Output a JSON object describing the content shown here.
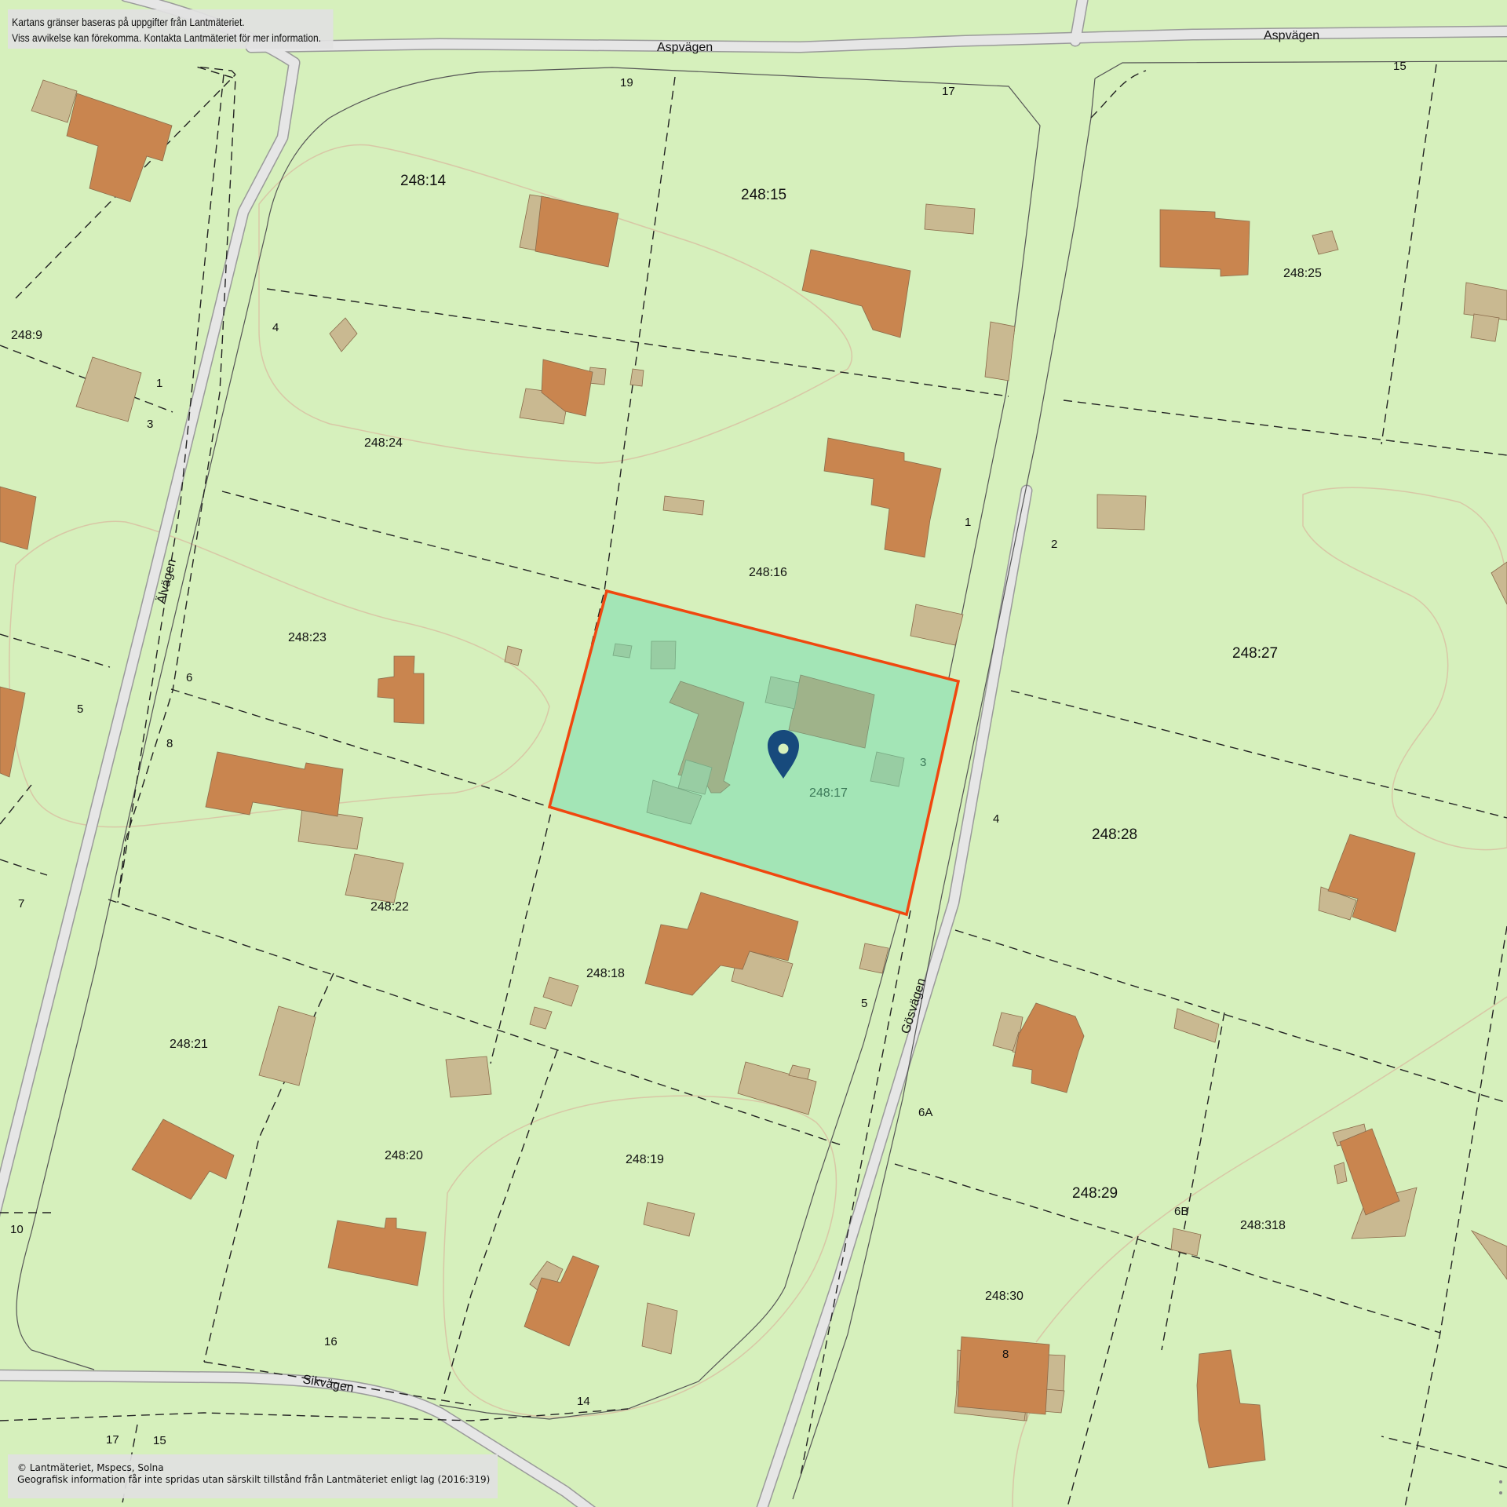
{
  "map": {
    "colors": {
      "land": "#d6f0bc",
      "building_main": "#c9854f",
      "building_annex": "#c9b991",
      "road": "#e6e6e6",
      "road_edge": "#9a9a9a",
      "selected_fill": "#a3e5b6",
      "selected_border": "#f0470f",
      "pin": "#174a7c"
    },
    "roads": {
      "aspvagen": "Aspvägen",
      "alvagen": "Älvägen",
      "gosvagen": "Gösvägen",
      "sikvagen": "Sikvägen"
    },
    "parcels": {
      "p248_14": "248:14",
      "p248_15": "248:15",
      "p248_25": "248:25",
      "p248_9": "248:9",
      "p248_24": "248:24",
      "p248_16": "248:16",
      "p248_23": "248:23",
      "p248_27": "248:27",
      "p248_17": "248:17",
      "p248_28": "248:28",
      "p248_22": "248:22",
      "p248_18": "248:18",
      "p248_21": "248:21",
      "p248_20": "248:20",
      "p248_19": "248:19",
      "p248_29": "248:29",
      "p248_318": "248:318",
      "p248_30": "248:30"
    },
    "addresses": {
      "a19": "19",
      "a17_top": "17",
      "a15_top": "15",
      "a4_left": "4",
      "a1_left": "1",
      "a3_left": "3",
      "a1_gos": "1",
      "a2_gos": "2",
      "a6": "6",
      "a5": "5",
      "a8_left": "8",
      "a3_sel": "3",
      "a4_gos": "4",
      "a7": "7",
      "a5_gos": "5",
      "a6A": "6A",
      "a6B": "6B",
      "a10": "10",
      "a16": "16",
      "a14": "14",
      "a8_bottom": "8",
      "a17_bottom": "17",
      "a15_bottom": "15"
    },
    "selected_parcel": {
      "id": "248:17",
      "marker": "location-pin"
    }
  },
  "notices": {
    "top_line1": "Kartans gränser baseras på uppgifter från Lantmäteriet.",
    "top_line2": "Viss avvikelse kan förekomma. Kontakta Lantmäteriet för mer information.",
    "bottom_line1": "© Lantmäteriet, Mspecs, Solna",
    "bottom_line2": "Geografisk information får inte spridas utan särskilt tillstånd från Lantmäteriet enligt lag (2016:319)"
  }
}
